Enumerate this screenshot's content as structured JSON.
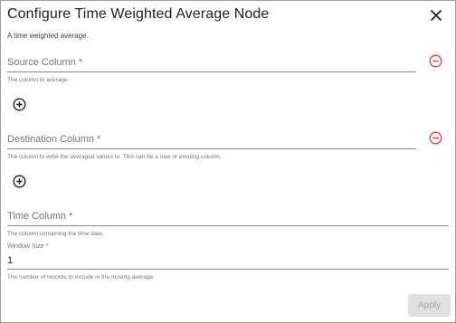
{
  "dialog": {
    "title": "Configure Time Weighted Average Node",
    "subtitle": "A time weighted average."
  },
  "fields": {
    "source": {
      "label": "Source Column *",
      "hint": "The column to average."
    },
    "destination": {
      "label": "Destination Column *",
      "hint": "The column to write the averaged values to. This can be a new or existing column."
    },
    "time": {
      "label": "Time Column *",
      "hint": "The column containing the time data."
    },
    "window": {
      "label": "Window Size *",
      "value": "1",
      "hint": "The number of records to include in the moving average."
    }
  },
  "actions": {
    "apply_label": "Apply"
  },
  "colors": {
    "remove_icon": "#e53935",
    "apply_bg": "#e0e0e0",
    "apply_text": "#a8a8a8"
  },
  "icons": {
    "close": "close-icon",
    "remove": "remove-circle-icon",
    "add": "add-circle-icon"
  }
}
